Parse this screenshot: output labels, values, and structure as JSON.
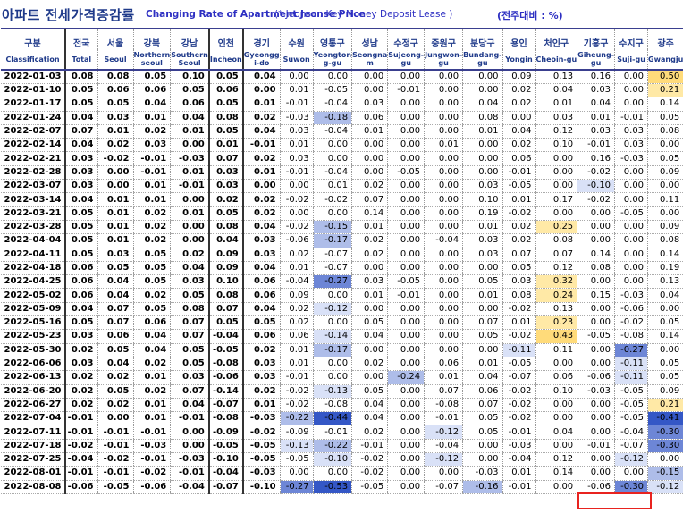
{
  "header": {
    "title_ko": "아파트 전세가격증감률",
    "title_en": "Changing Rate of Apartment Jeonse Price",
    "note": "(* Jeonse : Key Money Deposit Lease )",
    "unit": "(전주대비 : %)"
  },
  "columns": [
    {
      "ko": "구분",
      "en": "Classification"
    },
    {
      "ko": "전국",
      "en": "Total"
    },
    {
      "ko": "서울",
      "en": "Seoul"
    },
    {
      "ko": "강북",
      "en": "Northern seoul"
    },
    {
      "ko": "강남",
      "en": "Southern Seoul"
    },
    {
      "ko": "인천",
      "en": "Incheon"
    },
    {
      "ko": "경기",
      "en": "Gyeonggi-do"
    },
    {
      "ko": "수원",
      "en": "Suwon"
    },
    {
      "ko": "영통구",
      "en": "Yeongtong-gu"
    },
    {
      "ko": "성남",
      "en": "Seongnam"
    },
    {
      "ko": "수정구",
      "en": "Sujeong-gu"
    },
    {
      "ko": "중원구",
      "en": "Jungwon-gu"
    },
    {
      "ko": "분당구",
      "en": "Bundang-gu"
    },
    {
      "ko": "용인",
      "en": "Yongin"
    },
    {
      "ko": "처인구",
      "en": "Cheoin-gu"
    },
    {
      "ko": "기흥구",
      "en": "Giheung-gu"
    },
    {
      "ko": "수지구",
      "en": "Suji-gu"
    },
    {
      "ko": "광주",
      "en": "Gwangju"
    }
  ],
  "header_wrapped": {
    "Gyeonggi-do": [
      "Gyeongg",
      "i-do"
    ],
    "Yeongtong-gu": [
      "Yeongton",
      "g-gu"
    ],
    "Seongnam": [
      "Seongna",
      "m"
    ],
    "Sujeong-gu": [
      "Sujeong-",
      "gu"
    ],
    "Jungwon-gu": [
      "Jungwon-",
      "gu"
    ],
    "Bundang-gu": [
      "Bundang-",
      "gu"
    ],
    "Giheung-gu": [
      "Giheung-",
      "gu"
    ],
    "Northern seoul": [
      "Northern",
      "seoul"
    ],
    "Southern Seoul": [
      "Southern",
      "Seoul"
    ]
  },
  "rows": [
    [
      "2022-01-03",
      "0.08",
      "0.08",
      "0.05",
      "0.10",
      "0.05",
      "0.04",
      "0.00",
      "0.00",
      "0.00",
      "0.00",
      "0.00",
      "0.00",
      "0.09",
      "0.13",
      "0.16",
      "0.00",
      "0.50"
    ],
    [
      "2022-01-10",
      "0.05",
      "0.06",
      "0.06",
      "0.05",
      "0.06",
      "0.00",
      "0.01",
      "-0.05",
      "0.00",
      "-0.01",
      "0.00",
      "0.00",
      "0.02",
      "0.04",
      "0.03",
      "0.00",
      "0.21"
    ],
    [
      "2022-01-17",
      "0.05",
      "0.05",
      "0.04",
      "0.06",
      "0.05",
      "0.01",
      "-0.01",
      "-0.04",
      "0.03",
      "0.00",
      "0.00",
      "0.04",
      "0.02",
      "0.01",
      "0.04",
      "0.00",
      "0.14"
    ],
    [
      "2022-01-24",
      "0.04",
      "0.03",
      "0.01",
      "0.04",
      "0.08",
      "0.02",
      "-0.03",
      "-0.18",
      "0.06",
      "0.00",
      "0.00",
      "0.08",
      "0.00",
      "0.03",
      "0.01",
      "-0.01",
      "0.05"
    ],
    [
      "2022-02-07",
      "0.07",
      "0.01",
      "0.02",
      "0.01",
      "0.05",
      "0.04",
      "0.03",
      "-0.04",
      "0.01",
      "0.00",
      "0.00",
      "0.01",
      "0.04",
      "0.12",
      "0.03",
      "0.03",
      "0.08"
    ],
    [
      "2022-02-14",
      "0.04",
      "0.02",
      "0.03",
      "0.00",
      "0.01",
      "-0.01",
      "0.01",
      "0.00",
      "0.00",
      "0.00",
      "0.01",
      "0.00",
      "0.02",
      "0.10",
      "-0.01",
      "0.03",
      "0.00"
    ],
    [
      "2022-02-21",
      "0.03",
      "-0.02",
      "-0.01",
      "-0.03",
      "0.07",
      "0.02",
      "0.03",
      "0.00",
      "0.00",
      "0.00",
      "0.00",
      "0.00",
      "0.06",
      "0.00",
      "0.16",
      "-0.03",
      "0.05"
    ],
    [
      "2022-02-28",
      "0.03",
      "0.00",
      "-0.01",
      "0.01",
      "0.03",
      "0.01",
      "-0.01",
      "-0.04",
      "0.00",
      "-0.05",
      "0.00",
      "0.00",
      "-0.01",
      "0.00",
      "-0.02",
      "0.00",
      "0.09"
    ],
    [
      "2022-03-07",
      "0.03",
      "0.00",
      "0.01",
      "-0.01",
      "0.03",
      "0.00",
      "0.00",
      "0.01",
      "0.02",
      "0.00",
      "0.00",
      "0.03",
      "-0.05",
      "0.00",
      "-0.10",
      "0.00",
      "0.00"
    ],
    [
      "2022-03-14",
      "0.04",
      "0.01",
      "0.01",
      "0.00",
      "0.02",
      "0.02",
      "-0.02",
      "-0.02",
      "0.07",
      "0.00",
      "0.00",
      "0.10",
      "0.01",
      "0.17",
      "-0.02",
      "0.00",
      "0.11"
    ],
    [
      "2022-03-21",
      "0.05",
      "0.01",
      "0.02",
      "0.01",
      "0.05",
      "0.02",
      "0.00",
      "0.00",
      "0.14",
      "0.00",
      "0.00",
      "0.19",
      "-0.02",
      "0.00",
      "0.00",
      "-0.05",
      "0.00"
    ],
    [
      "2022-03-28",
      "0.05",
      "0.01",
      "0.02",
      "0.00",
      "0.08",
      "0.04",
      "-0.02",
      "-0.15",
      "0.01",
      "0.00",
      "0.00",
      "0.01",
      "0.02",
      "0.25",
      "0.00",
      "0.00",
      "0.09"
    ],
    [
      "2022-04-04",
      "0.05",
      "0.01",
      "0.02",
      "0.00",
      "0.04",
      "0.03",
      "-0.06",
      "-0.17",
      "0.02",
      "0.00",
      "-0.04",
      "0.03",
      "0.02",
      "0.08",
      "0.00",
      "0.00",
      "0.08"
    ],
    [
      "2022-04-11",
      "0.05",
      "0.03",
      "0.05",
      "0.02",
      "0.09",
      "0.03",
      "0.02",
      "-0.07",
      "0.02",
      "0.00",
      "0.00",
      "0.03",
      "0.07",
      "0.07",
      "0.14",
      "0.00",
      "0.14"
    ],
    [
      "2022-04-18",
      "0.06",
      "0.05",
      "0.05",
      "0.04",
      "0.09",
      "0.04",
      "0.01",
      "-0.07",
      "0.00",
      "0.00",
      "0.00",
      "0.00",
      "0.05",
      "0.12",
      "0.08",
      "0.00",
      "0.19"
    ],
    [
      "2022-04-25",
      "0.06",
      "0.04",
      "0.05",
      "0.03",
      "0.10",
      "0.06",
      "-0.04",
      "-0.27",
      "0.03",
      "-0.05",
      "0.00",
      "0.05",
      "0.03",
      "0.32",
      "0.00",
      "0.00",
      "0.13"
    ],
    [
      "2022-05-02",
      "0.06",
      "0.04",
      "0.02",
      "0.05",
      "0.08",
      "0.06",
      "0.09",
      "0.00",
      "0.01",
      "-0.01",
      "0.00",
      "0.01",
      "0.08",
      "0.24",
      "0.15",
      "-0.03",
      "0.04"
    ],
    [
      "2022-05-09",
      "0.04",
      "0.07",
      "0.05",
      "0.08",
      "0.07",
      "0.04",
      "0.02",
      "-0.12",
      "0.00",
      "0.00",
      "0.00",
      "0.00",
      "-0.02",
      "0.13",
      "0.00",
      "-0.06",
      "0.00"
    ],
    [
      "2022-05-16",
      "0.05",
      "0.07",
      "0.06",
      "0.07",
      "0.05",
      "0.05",
      "0.02",
      "0.00",
      "0.05",
      "0.00",
      "0.00",
      "0.07",
      "0.01",
      "0.23",
      "0.00",
      "-0.02",
      "0.05"
    ],
    [
      "2022-05-23",
      "0.03",
      "0.06",
      "0.04",
      "0.07",
      "-0.04",
      "0.06",
      "0.06",
      "-0.14",
      "0.04",
      "0.00",
      "0.00",
      "0.05",
      "-0.02",
      "0.43",
      "-0.05",
      "-0.08",
      "0.14"
    ],
    [
      "2022-05-30",
      "0.02",
      "0.05",
      "0.04",
      "0.05",
      "-0.05",
      "0.02",
      "0.01",
      "-0.17",
      "0.00",
      "0.00",
      "0.00",
      "0.00",
      "-0.11",
      "0.11",
      "0.00",
      "-0.27",
      "0.00"
    ],
    [
      "2022-06-06",
      "0.03",
      "0.04",
      "0.02",
      "0.05",
      "-0.08",
      "0.03",
      "0.01",
      "0.00",
      "0.02",
      "0.00",
      "0.06",
      "0.01",
      "-0.05",
      "0.00",
      "0.00",
      "-0.11",
      "0.05"
    ],
    [
      "2022-06-13",
      "0.02",
      "0.02",
      "0.01",
      "0.03",
      "-0.06",
      "0.03",
      "-0.01",
      "0.00",
      "0.00",
      "-0.24",
      "0.01",
      "0.04",
      "-0.07",
      "0.06",
      "-0.06",
      "-0.11",
      "0.05"
    ],
    [
      "2022-06-20",
      "0.02",
      "0.05",
      "0.02",
      "0.07",
      "-0.14",
      "0.02",
      "-0.02",
      "-0.13",
      "0.05",
      "0.00",
      "0.07",
      "0.06",
      "-0.02",
      "0.10",
      "-0.03",
      "-0.05",
      "0.09"
    ],
    [
      "2022-06-27",
      "0.02",
      "0.02",
      "0.01",
      "0.04",
      "-0.07",
      "0.01",
      "-0.02",
      "-0.08",
      "0.04",
      "0.00",
      "-0.08",
      "0.07",
      "-0.02",
      "0.00",
      "0.00",
      "-0.05",
      "0.21"
    ],
    [
      "2022-07-04",
      "-0.01",
      "0.00",
      "0.01",
      "-0.01",
      "-0.08",
      "-0.03",
      "-0.22",
      "-0.44",
      "0.04",
      "0.00",
      "-0.01",
      "0.05",
      "-0.02",
      "0.00",
      "0.00",
      "-0.05",
      "-0.41"
    ],
    [
      "2022-07-11",
      "-0.01",
      "-0.01",
      "-0.01",
      "0.00",
      "-0.09",
      "-0.02",
      "-0.09",
      "-0.01",
      "0.02",
      "0.00",
      "-0.12",
      "0.05",
      "-0.01",
      "0.04",
      "0.00",
      "-0.04",
      "-0.30"
    ],
    [
      "2022-07-18",
      "-0.02",
      "-0.01",
      "-0.03",
      "0.00",
      "-0.05",
      "-0.05",
      "-0.13",
      "-0.22",
      "-0.01",
      "0.00",
      "-0.04",
      "0.00",
      "-0.03",
      "0.00",
      "-0.01",
      "-0.07",
      "-0.30"
    ],
    [
      "2022-07-25",
      "-0.04",
      "-0.02",
      "-0.01",
      "-0.03",
      "-0.10",
      "-0.05",
      "-0.05",
      "-0.10",
      "-0.02",
      "0.00",
      "-0.12",
      "0.00",
      "-0.04",
      "0.12",
      "0.00",
      "-0.12",
      "0.00"
    ],
    [
      "2022-08-01",
      "-0.01",
      "-0.01",
      "-0.02",
      "-0.01",
      "-0.04",
      "-0.03",
      "0.00",
      "0.00",
      "-0.02",
      "0.00",
      "0.00",
      "-0.03",
      "0.01",
      "0.14",
      "0.00",
      "0.00",
      "-0.15"
    ],
    [
      "2022-08-08",
      "-0.06",
      "-0.05",
      "-0.06",
      "-0.04",
      "-0.07",
      "-0.10",
      "-0.27",
      "-0.53",
      "-0.05",
      "0.00",
      "-0.07",
      "-0.16",
      "-0.01",
      "0.00",
      "-0.06",
      "-0.30",
      "-0.12"
    ]
  ],
  "colors": {
    "header_text": "#1f3a8a",
    "title_en": "#2d2fc2",
    "highlight_box": "#e8231f",
    "positive_strong": "#ffdb7a",
    "negative_strong": "#3457c6"
  }
}
